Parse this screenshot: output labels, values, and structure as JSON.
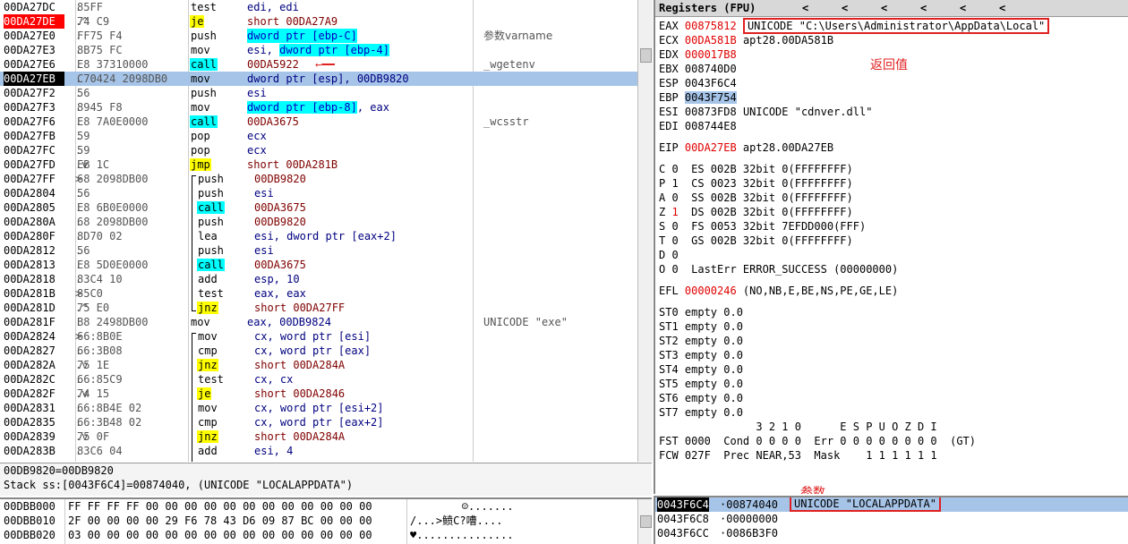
{
  "disasm": [
    {
      "addr": "00DA27DC",
      "mk": ".",
      "hex": "85FF",
      "mn": "test",
      "mn_hl": "",
      "op": "edi, edi",
      "cm": ""
    },
    {
      "addr": "00DA27DE",
      "mk": ".^",
      "hex": "74 C9",
      "mn": "je",
      "mn_hl": "yel",
      "op": "short 00DA27A9",
      "cm": "",
      "addr_style": "red"
    },
    {
      "addr": "00DA27E0",
      "mk": ".",
      "hex": "FF75 F4",
      "mn": "push",
      "mn_hl": "",
      "op": "dword ptr [ebp-C]",
      "op_hl": "cyan",
      "cm": "参数varname"
    },
    {
      "addr": "00DA27E3",
      "mk": ".",
      "hex": "8B75 FC",
      "mn": "mov",
      "mn_hl": "",
      "op": "esi, dword ptr [ebp-4]",
      "op_hl": "cyan",
      "cm": ""
    },
    {
      "addr": "00DA27E6",
      "mk": ".",
      "hex": "E8 37310000",
      "mn": "call",
      "mn_hl": "cyan",
      "op": "00DA5922",
      "cm": "_wgetenv",
      "arrow": true
    },
    {
      "addr": "00DA27EB",
      "mk": ".",
      "hex": "C70424 2098DB0",
      "mn": "mov",
      "mn_hl": "",
      "op": "dword ptr [esp], 00DB9820",
      "cm": "",
      "sel": true
    },
    {
      "addr": "00DA27F2",
      "mk": ".",
      "hex": "56",
      "mn": "push",
      "mn_hl": "",
      "op": "esi",
      "cm": ""
    },
    {
      "addr": "00DA27F3",
      "mk": ".",
      "hex": "8945 F8",
      "mn": "mov",
      "mn_hl": "",
      "op": "dword ptr [ebp-8], eax",
      "op_hl": "cyan",
      "cm": ""
    },
    {
      "addr": "00DA27F6",
      "mk": ".",
      "hex": "E8 7A0E0000",
      "mn": "call",
      "mn_hl": "cyan",
      "op": "00DA3675",
      "cm": "_wcsstr"
    },
    {
      "addr": "00DA27FB",
      "mk": ".",
      "hex": "59",
      "mn": "pop",
      "mn_hl": "",
      "op": "ecx",
      "cm": ""
    },
    {
      "addr": "00DA27FC",
      "mk": ".",
      "hex": "59",
      "mn": "pop",
      "mn_hl": "",
      "op": "ecx",
      "cm": ""
    },
    {
      "addr": "00DA27FD",
      "mk": ".v",
      "hex": "EB 1C",
      "mn": "jmp",
      "mn_hl": "yel",
      "op": "short 00DA281B",
      "cm": ""
    },
    {
      "addr": "00DA27FF",
      "mk": ">",
      "hex": "68 2098DB00",
      "mn": "push",
      "mn_hl": "",
      "op": "00DB9820",
      "cm": "",
      "ind": true
    },
    {
      "addr": "00DA2804",
      "mk": ".",
      "hex": "56",
      "mn": "push",
      "mn_hl": "",
      "op": "esi",
      "cm": "",
      "ind": true
    },
    {
      "addr": "00DA2805",
      "mk": ".",
      "hex": "E8 6B0E0000",
      "mn": "call",
      "mn_hl": "cyan",
      "op": "00DA3675",
      "cm": "",
      "ind": true
    },
    {
      "addr": "00DA280A",
      "mk": ".",
      "hex": "68 2098DB00",
      "mn": "push",
      "mn_hl": "",
      "op": "00DB9820",
      "cm": "",
      "ind": true
    },
    {
      "addr": "00DA280F",
      "mk": ".",
      "hex": "8D70 02",
      "mn": "lea",
      "mn_hl": "",
      "op": "esi, dword ptr [eax+2]",
      "cm": "",
      "ind": true
    },
    {
      "addr": "00DA2812",
      "mk": ".",
      "hex": "56",
      "mn": "push",
      "mn_hl": "",
      "op": "esi",
      "cm": "",
      "ind": true
    },
    {
      "addr": "00DA2813",
      "mk": ".",
      "hex": "E8 5D0E0000",
      "mn": "call",
      "mn_hl": "cyan",
      "op": "00DA3675",
      "cm": "",
      "ind": true
    },
    {
      "addr": "00DA2818",
      "mk": ".",
      "hex": "83C4 10",
      "mn": "add",
      "mn_hl": "",
      "op": "esp, 10",
      "cm": "",
      "ind": true
    },
    {
      "addr": "00DA281B",
      "mk": ">",
      "hex": "85C0",
      "mn": "test",
      "mn_hl": "",
      "op": "eax, eax",
      "cm": "",
      "ind": true
    },
    {
      "addr": "00DA281D",
      "mk": ".^",
      "hex": "75 E0",
      "mn": "jnz",
      "mn_hl": "yel",
      "op": "short 00DA27FF",
      "cm": "",
      "ind": true
    },
    {
      "addr": "00DA281F",
      "mk": ".",
      "hex": "B8 2498DB00",
      "mn": "mov",
      "mn_hl": "",
      "op": "eax, 00DB9824",
      "cm": "UNICODE \"exe\""
    },
    {
      "addr": "00DA2824",
      "mk": ">",
      "hex": "66:8B0E",
      "mn": "mov",
      "mn_hl": "",
      "op": "cx, word ptr [esi]",
      "cm": "",
      "ind": true
    },
    {
      "addr": "00DA2827",
      "mk": ".",
      "hex": "66:3B08",
      "mn": "cmp",
      "mn_hl": "",
      "op": "cx, word ptr [eax]",
      "cm": "",
      "ind": true
    },
    {
      "addr": "00DA282A",
      "mk": ".v",
      "hex": "75 1E",
      "mn": "jnz",
      "mn_hl": "yel",
      "op": "short 00DA284A",
      "cm": "",
      "ind": true
    },
    {
      "addr": "00DA282C",
      "mk": ".",
      "hex": "66:85C9",
      "mn": "test",
      "mn_hl": "",
      "op": "cx, cx",
      "cm": "",
      "ind": true
    },
    {
      "addr": "00DA282F",
      "mk": ".v",
      "hex": "74 15",
      "mn": "je",
      "mn_hl": "yel",
      "op": "short 00DA2846",
      "cm": "",
      "ind": true
    },
    {
      "addr": "00DA2831",
      "mk": ".",
      "hex": "66:8B4E 02",
      "mn": "mov",
      "mn_hl": "",
      "op": "cx, word ptr [esi+2]",
      "cm": "",
      "ind": true
    },
    {
      "addr": "00DA2835",
      "mk": ".",
      "hex": "66:3B48 02",
      "mn": "cmp",
      "mn_hl": "",
      "op": "cx, word ptr [eax+2]",
      "cm": "",
      "ind": true
    },
    {
      "addr": "00DA2839",
      "mk": ".v",
      "hex": "75 0F",
      "mn": "jnz",
      "mn_hl": "yel",
      "op": "short 00DA284A",
      "cm": "",
      "ind": true
    },
    {
      "addr": "00DA283B",
      "mk": ".",
      "hex": "83C6 04",
      "mn": "add",
      "mn_hl": "",
      "op": "esi, 4",
      "cm": "",
      "ind": true
    }
  ],
  "info": {
    "line1": "00DB9820=00DB9820",
    "line2": "Stack ss:[0043F6C4]=00874040, (UNICODE \"LOCALAPPDATA\")"
  },
  "dump": [
    {
      "addr": "00DBB000",
      "hex": "FF FF FF FF 00 00 00 00 00 00 00 00 00 00 00 00",
      "ascii": "        ☺......."
    },
    {
      "addr": "00DBB010",
      "hex": "2F 00 00 00 00 29 F6 78 43 D6 09 87 BC 00 00 00",
      "ascii": "/...>鲼C?嘈...."
    },
    {
      "addr": "00DBB020",
      "hex": "03 00 00 00 00 00 00 00 00 00 00 00 00 00 00 00",
      "ascii": "♥..............."
    }
  ],
  "regs": {
    "title": "Registers (FPU)",
    "nav": [
      "<",
      "<",
      "<",
      "<",
      "<",
      "<"
    ],
    "gp": [
      {
        "name": "EAX",
        "val": "00875812",
        "red": true,
        "desc": "UNICODE \"C:\\Users\\Administrator\\AppData\\Local\"",
        "boxed": true
      },
      {
        "name": "ECX",
        "val": "00DA581B",
        "red": true,
        "desc": "apt28.00DA581B"
      },
      {
        "name": "EDX",
        "val": "000017B8",
        "red": true,
        "desc": ""
      },
      {
        "name": "EBX",
        "val": "008740D0",
        "red": false,
        "desc": ""
      },
      {
        "name": "ESP",
        "val": "0043F6C4",
        "red": false,
        "desc": ""
      },
      {
        "name": "EBP",
        "val": "0043F754",
        "red": false,
        "desc": "",
        "hl": true
      },
      {
        "name": "ESI",
        "val": "00873FD8",
        "red": false,
        "desc": "UNICODE \"cdnver.dll\""
      },
      {
        "name": "EDI",
        "val": "008744E8",
        "red": false,
        "desc": ""
      }
    ],
    "eip": {
      "name": "EIP",
      "val": "00DA27EB",
      "desc": "apt28.00DA27EB"
    },
    "seg": [
      {
        "flag": "C",
        "fv": "0",
        "seg": "ES",
        "sv": "002B",
        "bits": "32bit",
        "rng": "0(FFFFFFFF)",
        "red": false
      },
      {
        "flag": "P",
        "fv": "1",
        "seg": "CS",
        "sv": "0023",
        "bits": "32bit",
        "rng": "0(FFFFFFFF)",
        "red": false
      },
      {
        "flag": "A",
        "fv": "0",
        "seg": "SS",
        "sv": "002B",
        "bits": "32bit",
        "rng": "0(FFFFFFFF)",
        "red": false
      },
      {
        "flag": "Z",
        "fv": "1",
        "seg": "DS",
        "sv": "002B",
        "bits": "32bit",
        "rng": "0(FFFFFFFF)",
        "red": true
      },
      {
        "flag": "S",
        "fv": "0",
        "seg": "FS",
        "sv": "0053",
        "bits": "32bit",
        "rng": "7EFDD000(FFF)",
        "red": false
      },
      {
        "flag": "T",
        "fv": "0",
        "seg": "GS",
        "sv": "002B",
        "bits": "32bit",
        "rng": "0(FFFFFFFF)",
        "red": false
      }
    ],
    "d_line": "D 0",
    "o_line": "O 0  LastErr ERROR_SUCCESS (00000000)",
    "efl": {
      "name": "EFL",
      "val": "00000246",
      "desc": "(NO,NB,E,BE,NS,PE,GE,LE)"
    },
    "st": [
      "ST0 empty 0.0",
      "ST1 empty 0.0",
      "ST2 empty 0.0",
      "ST3 empty 0.0",
      "ST4 empty 0.0",
      "ST5 empty 0.0",
      "ST6 empty 0.0",
      "ST7 empty 0.0"
    ],
    "fpu_hdr": "               3 2 1 0      E S P U O Z D I",
    "fst": "FST 0000  Cond 0 0 0 0  Err 0 0 0 0 0 0 0 0  (GT)",
    "fcw": "FCW 027F  Prec NEAR,53  Mask    1 1 1 1 1 1"
  },
  "annotations": {
    "ret_val": "返回值",
    "param": "参数"
  },
  "stack": [
    {
      "addr": "0043F6C4",
      "val": "00874040",
      "desc": "UNICODE \"LOCALAPPDATA\"",
      "sel": true
    },
    {
      "addr": "0043F6C8",
      "val": "00000000",
      "desc": ""
    },
    {
      "addr": "0043F6CC",
      "val": "0086B3F0",
      "desc": ""
    }
  ]
}
